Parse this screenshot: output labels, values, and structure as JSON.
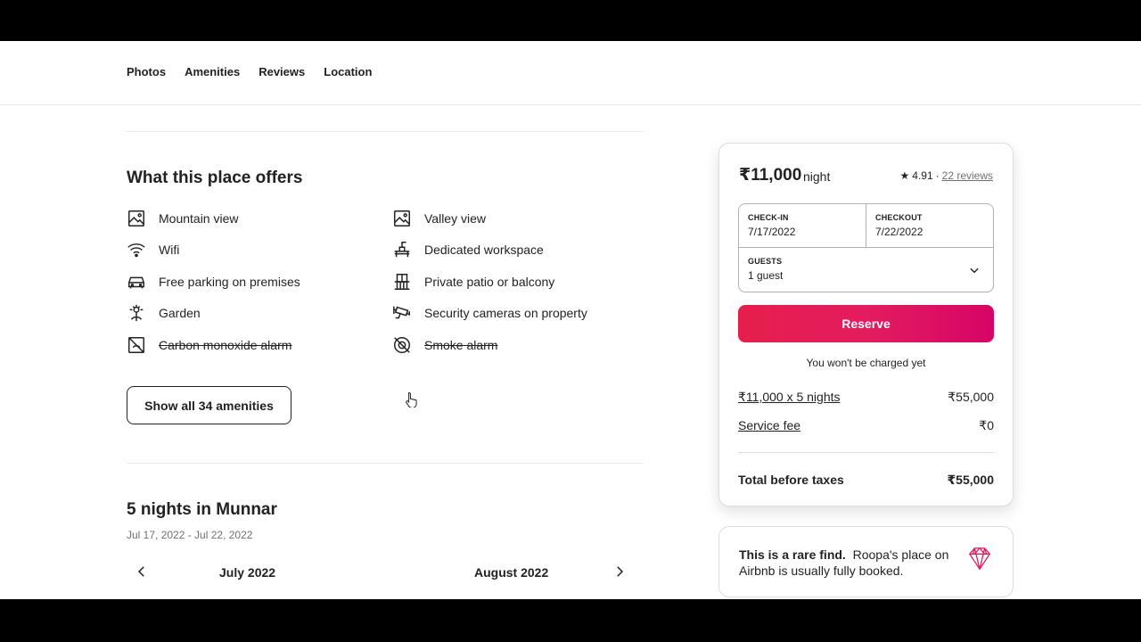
{
  "nav": {
    "links": [
      "Photos",
      "Amenities",
      "Reviews",
      "Location"
    ]
  },
  "offers": {
    "title": "What this place offers",
    "amenities": [
      {
        "label": "Mountain view",
        "icon": "mountain-view-icon",
        "unavailable": false
      },
      {
        "label": "Valley view",
        "icon": "valley-view-icon",
        "unavailable": false
      },
      {
        "label": "Wifi",
        "icon": "wifi-icon",
        "unavailable": false
      },
      {
        "label": "Dedicated workspace",
        "icon": "workspace-icon",
        "unavailable": false
      },
      {
        "label": "Free parking on premises",
        "icon": "car-icon",
        "unavailable": false
      },
      {
        "label": "Private patio or balcony",
        "icon": "balcony-icon",
        "unavailable": false
      },
      {
        "label": "Garden",
        "icon": "garden-icon",
        "unavailable": false
      },
      {
        "label": "Security cameras on property",
        "icon": "security-camera-icon",
        "unavailable": false
      },
      {
        "label": "Carbon monoxide alarm",
        "icon": "carbon-monoxide-alarm-icon",
        "unavailable": true
      },
      {
        "label": "Smoke alarm",
        "icon": "smoke-alarm-icon",
        "unavailable": true
      }
    ],
    "show_all_label": "Show all 34 amenities"
  },
  "stay": {
    "title": "5 nights in Munnar",
    "date_range": "Jul 17, 2022 - Jul 22, 2022",
    "month_left": "July 2022",
    "month_right": "August 2022"
  },
  "booking": {
    "price": "₹11,000",
    "price_unit": "night",
    "rating": "4.91",
    "separator": "·",
    "reviews": "22 reviews",
    "checkin_label": "CHECK-IN",
    "checkin_value": "7/17/2022",
    "checkout_label": "CHECKOUT",
    "checkout_value": "7/22/2022",
    "guests_label": "GUESTS",
    "guests_value": "1 guest",
    "reserve_label": "Reserve",
    "no_charge": "You won't be charged yet",
    "line_nights_label": "₹11,000 x 5 nights",
    "line_nights_value": "₹55,000",
    "service_fee_label": "Service fee",
    "service_fee_value": "₹0",
    "total_label": "Total before taxes",
    "total_value": "₹55,000",
    "accent_color": "#e31c5f"
  },
  "rare": {
    "bold": "This is a rare find.",
    "text": "Roopa's place on Airbnb is usually fully booked."
  }
}
